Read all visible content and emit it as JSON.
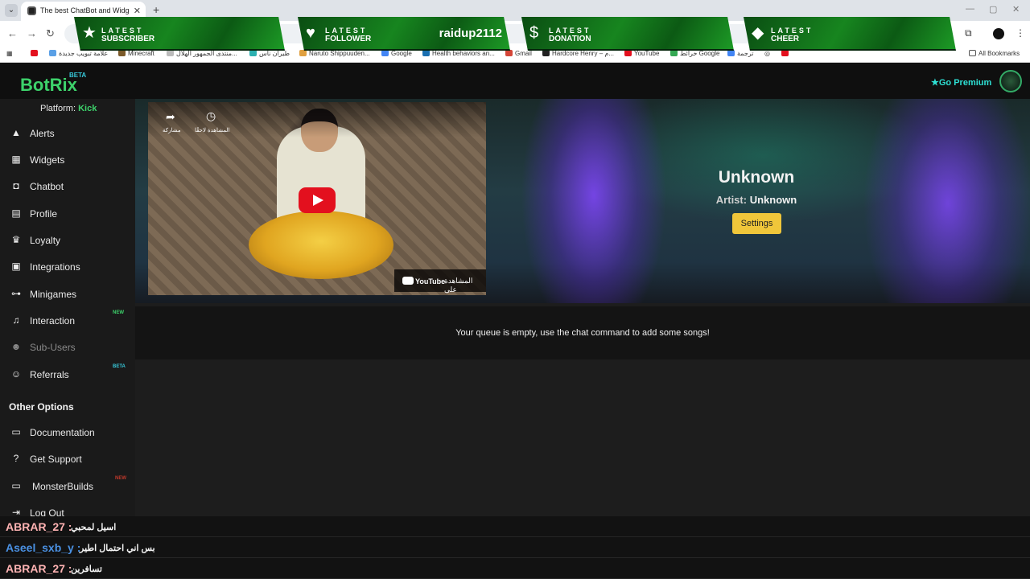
{
  "browser": {
    "tab_title": "The best ChatBot and Widgets",
    "bookmarks": [
      {
        "label": "علامة تبويب جديدة",
        "color": "#5aa0e6"
      },
      {
        "label": "Minecraft",
        "color": "#7b5a2a"
      },
      {
        "label": "منتدى الجمهور الهلال...",
        "color": "#bbbbbb"
      },
      {
        "label": "طيران ناس",
        "color": "#2bb0b0"
      },
      {
        "label": "Naruto Shippuuden...",
        "color": "#e0a040"
      },
      {
        "label": "Google",
        "color": "#4285f4"
      },
      {
        "label": "Health behaviors an...",
        "color": "#1a6fb0"
      },
      {
        "label": "Gmail",
        "color": "#d44638"
      },
      {
        "label": "Hardcore Henry – م...",
        "color": "#222222"
      },
      {
        "label": "YouTube",
        "color": "#e3101e"
      },
      {
        "label": "خرائط Google",
        "color": "#34a853"
      },
      {
        "label": "ترجمة",
        "color": "#4285f4"
      }
    ],
    "all_bookmarks": "All Bookmarks"
  },
  "overlay": {
    "banners": [
      {
        "line1": "LATEST",
        "line2": "SUBSCRIBER",
        "value": "",
        "icon": "star-icon"
      },
      {
        "line1": "LATEST",
        "line2": "FOLLOWER",
        "value": "raidup2112",
        "icon": "heart-icon"
      },
      {
        "line1": "LATEST",
        "line2": "DONATION",
        "value": "",
        "icon": "dollar-icon"
      },
      {
        "line1": "LATEST",
        "line2": "CHEER",
        "value": "",
        "icon": "diamond-icon"
      }
    ],
    "accent": "#17851f"
  },
  "header": {
    "logo": "BotRix",
    "beta": "BETA",
    "premium": "Go Premium"
  },
  "sidebar": {
    "platform_label": "Platform:",
    "platform_value": "Kick",
    "items": [
      {
        "label": "Alerts",
        "icon": "warning-icon",
        "badge": ""
      },
      {
        "label": "Widgets",
        "icon": "grid-icon",
        "badge": ""
      },
      {
        "label": "Chatbot",
        "icon": "robot-icon",
        "badge": ""
      },
      {
        "label": "Profile",
        "icon": "id-card-icon",
        "badge": ""
      },
      {
        "label": "Loyalty",
        "icon": "trophy-icon",
        "badge": ""
      },
      {
        "label": "Integrations",
        "icon": "chat-icon",
        "badge": ""
      },
      {
        "label": "Minigames",
        "icon": "gamepad-icon",
        "badge": ""
      },
      {
        "label": "Interaction",
        "icon": "music-icon",
        "badge": "NEW"
      },
      {
        "label": "Sub-Users",
        "icon": "users-icon",
        "badge": ""
      },
      {
        "label": "Referrals",
        "icon": "user-group-icon",
        "badge": "BETA"
      }
    ],
    "other_title": "Other Options",
    "other_items": [
      {
        "label": "Documentation",
        "icon": "scroll-icon",
        "badge": ""
      },
      {
        "label": "Get Support",
        "icon": "question-icon",
        "badge": ""
      },
      {
        "label": "MonsterBuilds",
        "icon": "laptop-icon",
        "badge": "NEW"
      },
      {
        "label": "Log Out",
        "icon": "logout-icon",
        "badge": ""
      }
    ]
  },
  "player": {
    "video": {
      "share_label": "مشاركة",
      "watch_later_label": "المشاهدة لاحقًا",
      "watch_on": "المشاهدة على",
      "youtube": "YouTube"
    },
    "song_title": "Unknown",
    "artist_label": "Artist:",
    "artist_value": "Unknown",
    "settings_label": "Settings"
  },
  "queue": {
    "empty_message": "Your queue is empty, use the chat command to add some songs!"
  },
  "chat": [
    {
      "user": "ABRAR_27 :",
      "text": "اسيل لمحبي",
      "color": "#ffb3b3"
    },
    {
      "user": "Aseel_sxb_y :",
      "text": "بس اني احتمال اطير",
      "color": "#4a90e2"
    },
    {
      "user": "ABRAR_27 :",
      "text": "تسافرين",
      "color": "#ffb3b3"
    }
  ]
}
